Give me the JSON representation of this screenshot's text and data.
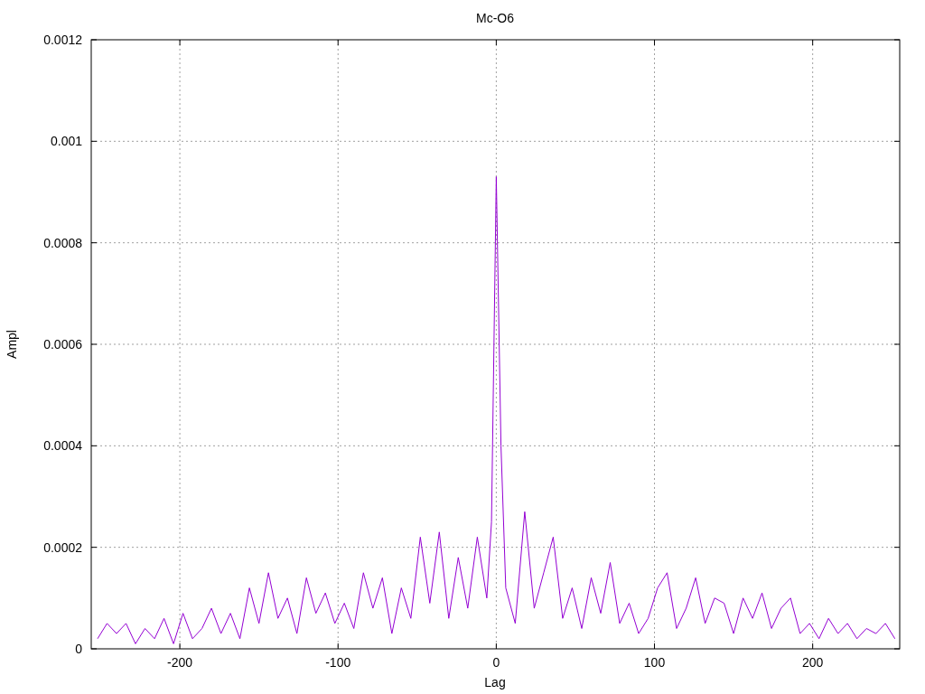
{
  "chart_data": {
    "type": "line",
    "title": "Mc-O6",
    "xlabel": "Lag",
    "ylabel": "Ampl",
    "grid": true,
    "xlim": [
      -256,
      255
    ],
    "ylim": [
      0,
      0.0012
    ],
    "xticks": [
      -200,
      -100,
      0,
      100,
      200
    ],
    "yticks": [
      0,
      0.0002,
      0.0004,
      0.0006,
      0.0008,
      0.001,
      0.0012
    ],
    "x": [
      -252,
      -246,
      -240,
      -234,
      -228,
      -222,
      -216,
      -210,
      -204,
      -198,
      -192,
      -186,
      -180,
      -174,
      -168,
      -162,
      -156,
      -150,
      -144,
      -138,
      -132,
      -126,
      -120,
      -114,
      -108,
      -102,
      -96,
      -90,
      -84,
      -78,
      -72,
      -66,
      -60,
      -54,
      -48,
      -42,
      -36,
      -30,
      -24,
      -18,
      -12,
      -6,
      -3,
      0,
      3,
      6,
      12,
      18,
      24,
      30,
      36,
      42,
      48,
      54,
      60,
      66,
      72,
      78,
      84,
      90,
      96,
      102,
      108,
      114,
      120,
      126,
      132,
      138,
      144,
      150,
      156,
      162,
      168,
      174,
      180,
      186,
      192,
      198,
      204,
      210,
      216,
      222,
      228,
      234,
      240,
      246,
      252
    ],
    "series": [
      {
        "color": "#9400d3",
        "values": [
          2e-05,
          5e-05,
          3e-05,
          5e-05,
          1e-05,
          4e-05,
          2e-05,
          6e-05,
          1e-05,
          7e-05,
          2e-05,
          4e-05,
          8e-05,
          3e-05,
          7e-05,
          2e-05,
          0.00012,
          5e-05,
          0.00015,
          6e-05,
          0.0001,
          3e-05,
          0.00014,
          7e-05,
          0.00011,
          5e-05,
          9e-05,
          4e-05,
          0.00015,
          8e-05,
          0.00014,
          3e-05,
          0.00012,
          6e-05,
          0.00022,
          9e-05,
          0.00023,
          6e-05,
          0.00018,
          8e-05,
          0.00022,
          0.0001,
          0.00025,
          0.00093,
          0.0004,
          0.00012,
          5e-05,
          0.00027,
          8e-05,
          0.00015,
          0.00022,
          6e-05,
          0.00012,
          4e-05,
          0.00014,
          7e-05,
          0.00017,
          5e-05,
          9e-05,
          3e-05,
          6e-05,
          0.00012,
          0.00015,
          4e-05,
          8e-05,
          0.00014,
          5e-05,
          0.0001,
          9e-05,
          3e-05,
          0.0001,
          6e-05,
          0.00011,
          4e-05,
          8e-05,
          0.0001,
          3e-05,
          5e-05,
          2e-05,
          6e-05,
          3e-05,
          5e-05,
          2e-05,
          4e-05,
          3e-05,
          5e-05,
          2e-05
        ]
      }
    ]
  }
}
